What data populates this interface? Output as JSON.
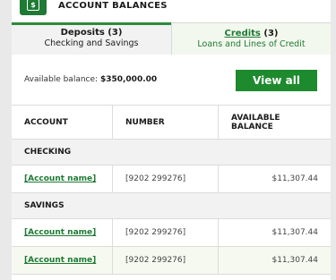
{
  "header": {
    "title": "ACCOUNT BALANCES",
    "icon": "dollar-card-icon"
  },
  "tabs": [
    {
      "title": "Deposits (3)",
      "subtitle": "Checking and Savings"
    },
    {
      "link": "Credits",
      "count": "(3)",
      "subtitle": "Loans and Lines of Credit"
    }
  ],
  "balance": {
    "label": "Available balance:",
    "amount": "$350,000.00"
  },
  "view_all_label": "View all",
  "table": {
    "columns": [
      "ACCOUNT",
      "NUMBER",
      "AVAILABLE BALANCE"
    ],
    "sections": [
      {
        "title": "CHECKING",
        "rows": [
          {
            "name": "[Account name]",
            "number": "[9202 299276]",
            "balance": "$11,307.44"
          }
        ]
      },
      {
        "title": "SAVINGS",
        "rows": [
          {
            "name": "[Account name]",
            "number": "[9202 299276]",
            "balance": "$11,307.44"
          },
          {
            "name": "[Account name]",
            "number": "[9202 299276]",
            "balance": "$11,307.44"
          }
        ]
      }
    ]
  },
  "colors": {
    "accent": "#1e8a2e",
    "link": "#1e7a34",
    "alt_row": "#f5f9f0"
  }
}
